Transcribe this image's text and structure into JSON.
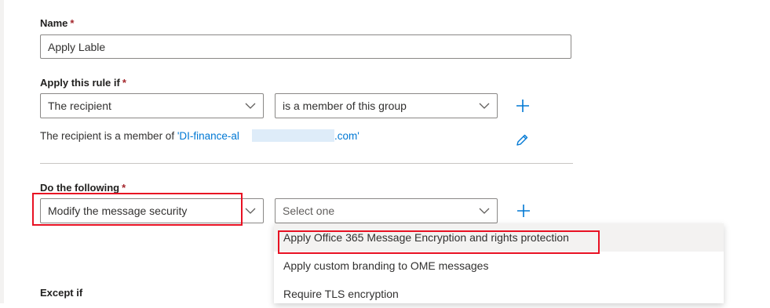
{
  "name_section": {
    "label": "Name",
    "required": "*",
    "value": "Apply Lable"
  },
  "condition": {
    "label": "Apply this rule if",
    "required": "*",
    "subject_select": "The recipient",
    "predicate_select": "is a member of this group",
    "summary_prefix": "The recipient is a member of ",
    "summary_link_start": "'DI-finance-al",
    "summary_link_end": ".com'"
  },
  "action": {
    "label": "Do the following",
    "required": "*",
    "action_select": "Modify the message security",
    "option_select_placeholder": "Select one",
    "options": [
      "Apply Office 365 Message Encryption and rights protection",
      "Apply custom branding to OME messages",
      "Require TLS encryption"
    ]
  },
  "exception": {
    "label": "Except if"
  },
  "colors": {
    "accent": "#0078d4",
    "highlight": "#e81123"
  },
  "icons": [
    "chevron-down-icon",
    "plus-icon",
    "pencil-icon"
  ]
}
